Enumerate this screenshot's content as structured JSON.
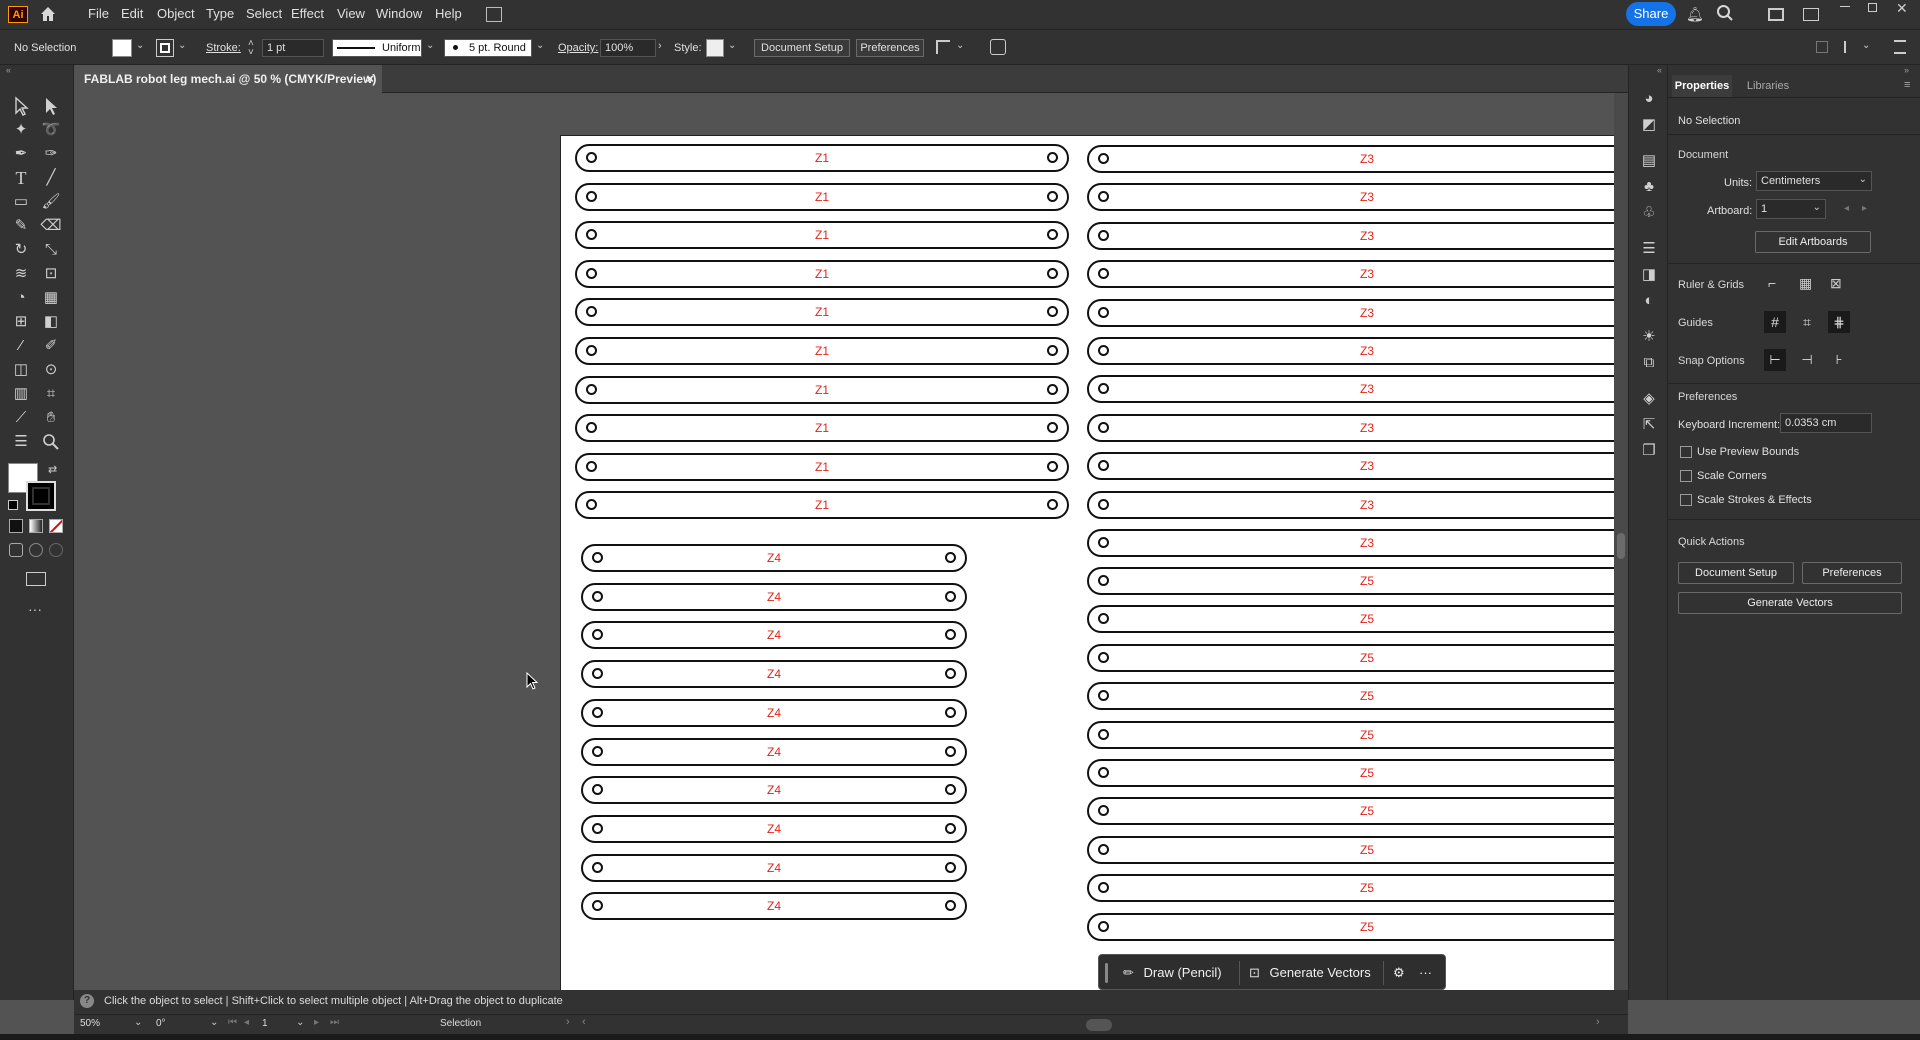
{
  "app": {
    "logo": "Ai",
    "menus": [
      "File",
      "Edit",
      "Object",
      "Type",
      "Select",
      "Effect",
      "View",
      "Window",
      "Help"
    ],
    "share_label": "Share"
  },
  "control_bar": {
    "selection_state": "No Selection",
    "stroke_label": "Stroke:",
    "stroke_weight": "1 pt",
    "stroke_profile": "Uniform",
    "brush": "5 pt. Round",
    "opacity_label": "Opacity:",
    "opacity_value": "100%",
    "style_label": "Style:",
    "document_setup": "Document Setup",
    "preferences": "Preferences"
  },
  "document_tab": {
    "title": "FABLAB robot leg mech.ai @ 50 % (CMYK/Preview)",
    "close_glyph": "×"
  },
  "artboard": {
    "z1_labels": [
      "Z1",
      "Z1",
      "Z1",
      "Z1",
      "Z1",
      "Z1",
      "Z1",
      "Z1",
      "Z1",
      "Z1"
    ],
    "z4_labels": [
      "Z4",
      "Z4",
      "Z4",
      "Z4",
      "Z4",
      "Z4",
      "Z4",
      "Z4",
      "Z4",
      "Z4"
    ],
    "z3_labels": [
      "Z3",
      "Z3",
      "Z3",
      "Z3",
      "Z3",
      "Z3",
      "Z3",
      "Z3",
      "Z3",
      "Z3",
      "Z3"
    ],
    "z5_labels": [
      "Z5",
      "Z5",
      "Z5",
      "Z5",
      "Z5",
      "Z5",
      "Z5",
      "Z5",
      "Z5",
      "Z5"
    ]
  },
  "taskbar": {
    "draw_label": "Draw (Pencil)",
    "generate_label": "Generate Vectors"
  },
  "properties_panel": {
    "tabs": [
      "Properties",
      "Libraries"
    ],
    "no_selection": "No Selection",
    "document_head": "Document",
    "units_label": "Units:",
    "units_value": "Centimeters",
    "artboard_label": "Artboard:",
    "artboard_value": "1",
    "edit_artboards": "Edit Artboards",
    "ruler_grids": "Ruler & Grids",
    "guides": "Guides",
    "snap_options": "Snap Options",
    "preferences_head": "Preferences",
    "keyboard_increment_label": "Keyboard Increment:",
    "keyboard_increment_value": "0.0353 cm",
    "use_preview_bounds": "Use Preview Bounds",
    "scale_corners": "Scale Corners",
    "scale_strokes": "Scale Strokes & Effects",
    "quick_actions": "Quick Actions",
    "qa_document_setup": "Document Setup",
    "qa_preferences": "Preferences",
    "qa_generate_vectors": "Generate Vectors"
  },
  "hint_bar": {
    "text": "Click the object to select  |  Shift+Click to select multiple object  |  Alt+Drag the object to duplicate"
  },
  "status_bar": {
    "zoom": "50%",
    "rotation": "0°",
    "artboard_nav": "1",
    "tool": "Selection"
  },
  "colors": {
    "label_red": "#e2231a",
    "share_blue": "#1473e6"
  }
}
